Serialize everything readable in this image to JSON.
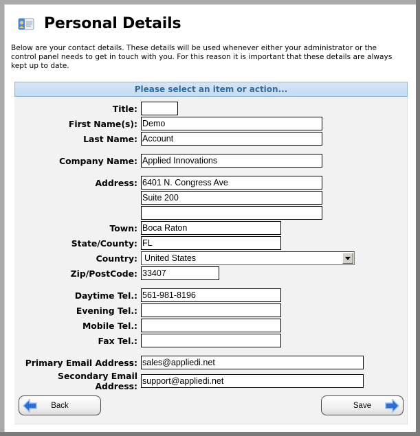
{
  "page": {
    "title": "Personal Details",
    "icon": "contact-card-icon",
    "intro": "Below are your contact details. These details will be used whenever either your administrator or the control panel needs to get in touch with you. For this reason it is important that these details are always kept up to date."
  },
  "panel": {
    "header": "Please select an item or action..."
  },
  "form": {
    "title": {
      "label": "Title:",
      "value": ""
    },
    "first_name": {
      "label": "First Name(s):",
      "value": "Demo"
    },
    "last_name": {
      "label": "Last Name:",
      "value": "Account"
    },
    "company": {
      "label": "Company Name:",
      "value": "Applied Innovations"
    },
    "address": {
      "label": "Address:",
      "line1": "6401 N. Congress Ave",
      "line2": "Suite 200",
      "line3": ""
    },
    "town": {
      "label": "Town:",
      "value": "Boca Raton"
    },
    "state": {
      "label": "State/County:",
      "value": "FL"
    },
    "country": {
      "label": "Country:",
      "value": "United States"
    },
    "zip": {
      "label": "Zip/PostCode:",
      "value": "33407"
    },
    "daytime_tel": {
      "label": "Daytime Tel.:",
      "value": "561-981-8196"
    },
    "evening_tel": {
      "label": "Evening Tel.:",
      "value": ""
    },
    "mobile_tel": {
      "label": "Mobile Tel.:",
      "value": ""
    },
    "fax_tel": {
      "label": "Fax Tel.:",
      "value": ""
    },
    "primary_email": {
      "label": "Primary Email Address:",
      "value": "sales@appliedi.net"
    },
    "secondary_email": {
      "label_line1": "Secondary Email",
      "label_line2": "Address:",
      "value": "support@appliedi.net"
    }
  },
  "buttons": {
    "back": {
      "label": "Back",
      "icon": "arrow-left-icon"
    },
    "save": {
      "label": "Save",
      "icon": "arrow-right-icon"
    }
  },
  "colors": {
    "panel_header_bg": "#c3dcf2",
    "panel_header_text": "#346a9c",
    "panel_bg": "#f2f2f2",
    "arrow_blue": "#2a6fd6"
  }
}
